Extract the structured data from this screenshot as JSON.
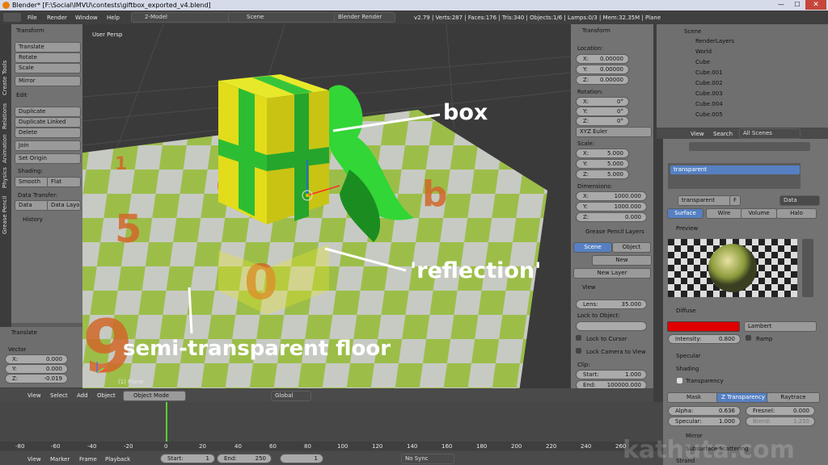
{
  "titlebar": {
    "title": "Blender* [F:\\Social\\IMVU\\contests\\giftbox_exported_v4.blend]"
  },
  "topbar": {
    "menus": [
      "File",
      "Render",
      "Window",
      "Help"
    ],
    "layout": "2-Model",
    "scene": "Scene",
    "engine": "Blender Render",
    "stats": "v2.79 | Verts:287 | Faces:176 | Tris:340 | Objects:1/6 | Lamps:0/3 | Mem:32.35M | Plane"
  },
  "tool_tabs": [
    "Tools",
    "Create",
    "Relations",
    "Animation",
    "Physics",
    "Grease Pencil"
  ],
  "tools": {
    "transform_header": "Transform",
    "translate": "Translate",
    "rotate": "Rotate",
    "scale": "Scale",
    "mirror": "Mirror",
    "edit_header": "Edit",
    "duplicate": "Duplicate",
    "duplicate_linked": "Duplicate Linked",
    "delete": "Delete",
    "join": "Join",
    "set_origin": "Set Origin",
    "shading": "Shading:",
    "smooth": "Smooth",
    "flat": "Flat",
    "data_transfer": "Data Transfer:",
    "data": "Data",
    "data_layo": "Data Layo",
    "history": "History"
  },
  "operator": {
    "header": "Translate",
    "vector": "Vector",
    "x": "0.000",
    "y": "0.000",
    "z": "-0.019"
  },
  "viewport": {
    "label": "User Persp",
    "object_label": "(1) Plane"
  },
  "annotations": {
    "box": "box",
    "reflection": "'reflection'",
    "floor": "semi-transparent floor"
  },
  "npanel": {
    "transform_header": "Transform",
    "location": "Location:",
    "loc": [
      "0.00000",
      "0.00000",
      "0.00000"
    ],
    "rotation": "Rotation:",
    "rot": [
      "0°",
      "0°",
      "0°"
    ],
    "euler": "XYZ Euler",
    "scale": "Scale:",
    "scl": [
      "5.000",
      "5.000",
      "5.000"
    ],
    "dimensions": "Dimensions:",
    "dim": [
      "1000.000",
      "1000.000",
      "0.000"
    ],
    "gp_header": "Grease Pencil Layers",
    "gp_scene": "Scene",
    "gp_object": "Object",
    "gp_new": "New",
    "gp_new_layer": "New Layer",
    "view_header": "View",
    "lens": "Lens:",
    "lens_val": "35.000",
    "lock_to_object": "Lock to Object:",
    "lock_to_cursor": "Lock to Cursor",
    "lock_camera": "Lock Camera to View",
    "clip": "Clip:",
    "clip_start": "Start:",
    "clip_start_val": "1.000",
    "clip_end": "End:",
    "clip_end_val": "100000.000"
  },
  "outliner": {
    "items": [
      "Scene",
      "RenderLayers",
      "World",
      "Cube",
      "Cube.001",
      "Cube.002",
      "Cube.003",
      "Cube.004",
      "Cube.005"
    ],
    "view": "View",
    "search": "Search",
    "all_scenes": "All Scenes"
  },
  "properties": {
    "material_slot": "transparent",
    "material_name": "transparent",
    "f": "F",
    "data": "Data",
    "tabs": [
      "Surface",
      "Wire",
      "Volume",
      "Halo"
    ],
    "preview": "Preview",
    "diffuse": "Diffuse",
    "diffuse_color": "#e00000",
    "lambert": "Lambert",
    "intensity": "Intensity:",
    "intensity_val": "0.800",
    "ramp": "Ramp",
    "specular": "Specular",
    "shading": "Shading",
    "transparency": "Transparency",
    "trans_tabs": [
      "Mask",
      "Z Transparency",
      "Raytrace"
    ],
    "alpha": "Alpha:",
    "alpha_val": "0.636",
    "fresnel": "Fresnel:",
    "fresnel_val": "0.000",
    "specular_f": "Specular:",
    "specular_val": "1.000",
    "blend": "Blend:",
    "blend_val": "1.250",
    "mirror": "Mirror",
    "sss": "Subsurface Scattering",
    "strand": "Strand"
  },
  "viewport_header": {
    "menus": [
      "View",
      "Select",
      "Add",
      "Object"
    ],
    "mode": "Object Mode",
    "orientation": "Global"
  },
  "timeline": {
    "ticks": [
      "-80",
      "-60",
      "-40",
      "-20",
      "0",
      "20",
      "40",
      "60",
      "80",
      "100",
      "120",
      "140",
      "160",
      "180",
      "200",
      "220",
      "240",
      "260"
    ],
    "menus": [
      "View",
      "Marker",
      "Frame",
      "Playback"
    ],
    "start": "Start:",
    "start_val": "1",
    "end": "End:",
    "end_val": "250",
    "current": "1",
    "sync": "No Sync"
  },
  "watermark": "kathuta.com"
}
